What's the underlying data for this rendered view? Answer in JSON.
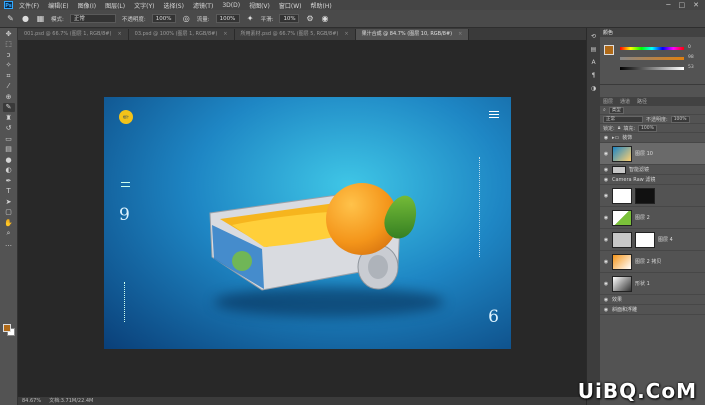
{
  "menubar": {
    "app_badge": "Ps",
    "items": [
      "文件(F)",
      "编辑(E)",
      "图像(I)",
      "图层(L)",
      "文字(Y)",
      "选择(S)",
      "滤镜(T)",
      "3D(D)",
      "视图(V)",
      "窗口(W)",
      "帮助(H)"
    ]
  },
  "options": {
    "mode_label": "模式:",
    "mode_value": "正常",
    "opacity_label": "不透明度:",
    "opacity_value": "100%",
    "flow_label": "流量:",
    "flow_value": "100%",
    "smooth_label": "平滑:",
    "smooth_value": "10%"
  },
  "tabs": [
    {
      "label": "001.psd @ 66.7% (图层 1, RGB/8#)"
    },
    {
      "label": "03.psd @ 100% (图层 1, RGB/8#)"
    },
    {
      "label": "所用素材.psd @ 66.7% (图层 5, RGB/8#)"
    },
    {
      "label": "果汁合成 @ 84.7% (图层 10, RGB/8#)",
      "active": true
    }
  ],
  "artwork": {
    "logo_text": "橙汁",
    "number_top": "9",
    "number_bottom": "6"
  },
  "status": {
    "zoom": "84.67%",
    "doc": "文档:3.71M/22.4M"
  },
  "color_panel": {
    "tabs": [
      "颜色"
    ],
    "values": [
      "0",
      "98",
      "53"
    ],
    "fg_color": "#b06a18"
  },
  "layers_panel": {
    "tabs": [
      "图层",
      "通道",
      "路径"
    ],
    "kind_label": "类型",
    "blend": "正常",
    "opacity_label": "不透明度:",
    "opacity_value": "100%",
    "lock_label": "锁定:",
    "fill_label": "填充:",
    "fill_value": "100%",
    "group": "装饰",
    "layers": [
      {
        "name": "图层 10",
        "thumb": "t1",
        "sel": true
      },
      {
        "name": "智能滤镜",
        "thumb": "t4",
        "sub": true
      },
      {
        "name": "Camera Raw 滤镜",
        "thumb": "",
        "sub": true
      },
      {
        "name": "",
        "thumb": "t2"
      },
      {
        "name": "图层 2",
        "thumb": "t3"
      },
      {
        "name": "图层 4",
        "thumb": "t4"
      },
      {
        "name": "图层 2 拷贝",
        "thumb": "t5"
      },
      {
        "name": "形状 1",
        "thumb": "t6"
      },
      {
        "name": "效果",
        "thumb": "",
        "sub": true
      },
      {
        "name": "斜面和浮雕",
        "thumb": "",
        "sub": true
      }
    ]
  },
  "watermark": "UiBQ.CoM"
}
